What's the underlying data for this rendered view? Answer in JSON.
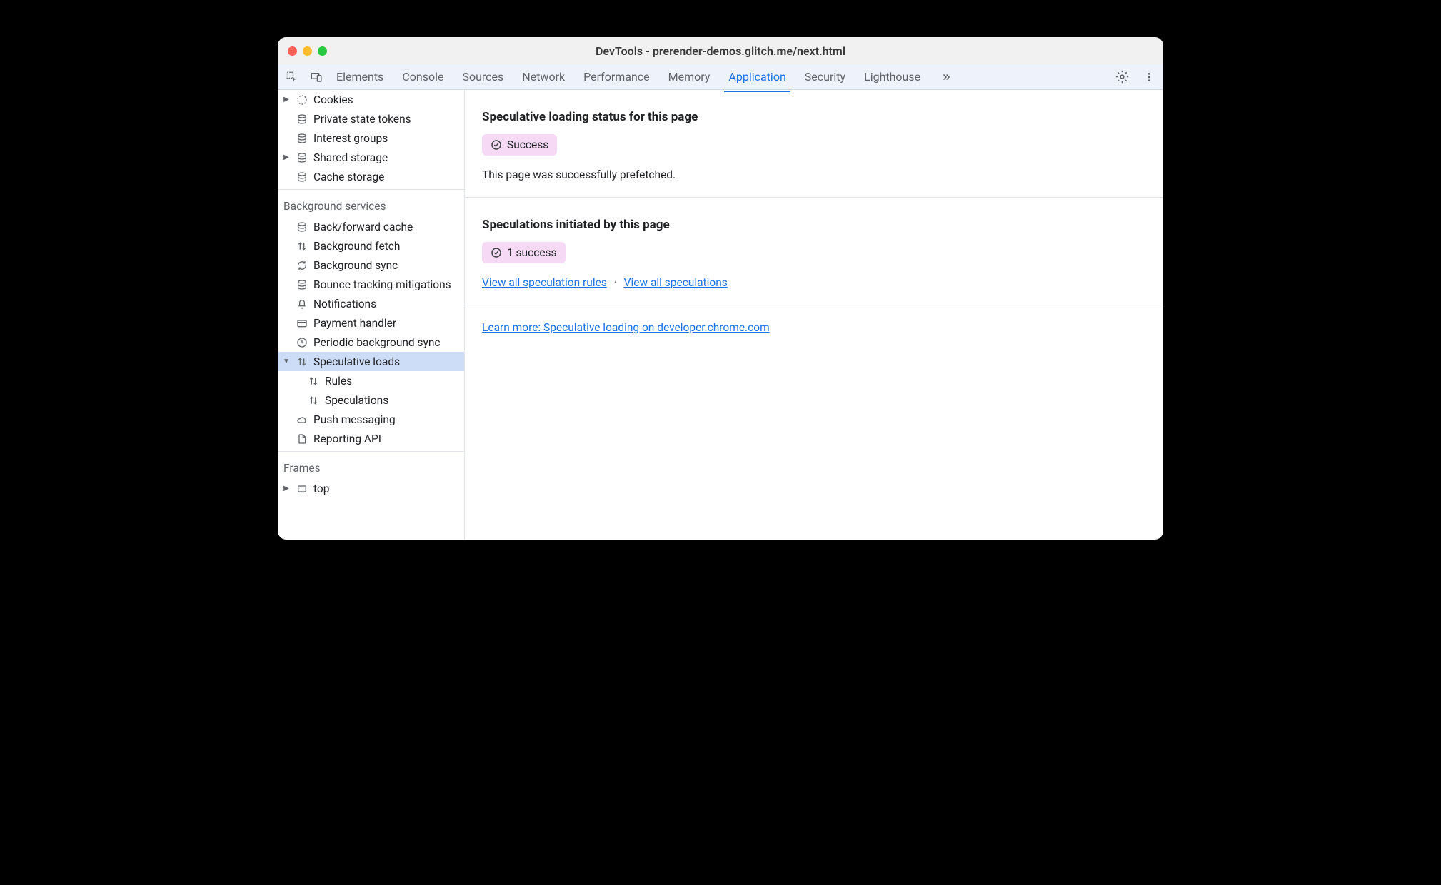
{
  "window": {
    "title": "DevTools - prerender-demos.glitch.me/next.html"
  },
  "tabs": {
    "items": [
      "Elements",
      "Console",
      "Sources",
      "Network",
      "Performance",
      "Memory",
      "Application",
      "Security",
      "Lighthouse"
    ],
    "active_index": 6
  },
  "sidebar": {
    "storage_items": [
      {
        "label": "Cookies",
        "icon": "cookie",
        "expandable": true
      },
      {
        "label": "Private state tokens",
        "icon": "db"
      },
      {
        "label": "Interest groups",
        "icon": "db"
      },
      {
        "label": "Shared storage",
        "icon": "db",
        "expandable": true
      },
      {
        "label": "Cache storage",
        "icon": "db"
      }
    ],
    "bg_section_title": "Background services",
    "bg_items": [
      {
        "label": "Back/forward cache",
        "icon": "db"
      },
      {
        "label": "Background fetch",
        "icon": "updown"
      },
      {
        "label": "Background sync",
        "icon": "sync"
      },
      {
        "label": "Bounce tracking mitigations",
        "icon": "db"
      },
      {
        "label": "Notifications",
        "icon": "bell"
      },
      {
        "label": "Payment handler",
        "icon": "card"
      },
      {
        "label": "Periodic background sync",
        "icon": "clock"
      },
      {
        "label": "Speculative loads",
        "icon": "updown",
        "expandable": true,
        "expanded": true,
        "selected": true,
        "children": [
          {
            "label": "Rules",
            "icon": "updown"
          },
          {
            "label": "Speculations",
            "icon": "updown"
          }
        ]
      },
      {
        "label": "Push messaging",
        "icon": "cloud"
      },
      {
        "label": "Reporting API",
        "icon": "document"
      }
    ],
    "frames_section_title": "Frames",
    "frames_items": [
      {
        "label": "top",
        "icon": "frame",
        "expandable": true
      }
    ]
  },
  "main": {
    "section1": {
      "heading": "Speculative loading status for this page",
      "status_label": "Success",
      "description": "This page was successfully prefetched."
    },
    "section2": {
      "heading": "Speculations initiated by this page",
      "status_label": "1 success",
      "link1": "View all speculation rules",
      "link2": "View all speculations"
    },
    "learn_more": "Learn more: Speculative loading on developer.chrome.com"
  }
}
